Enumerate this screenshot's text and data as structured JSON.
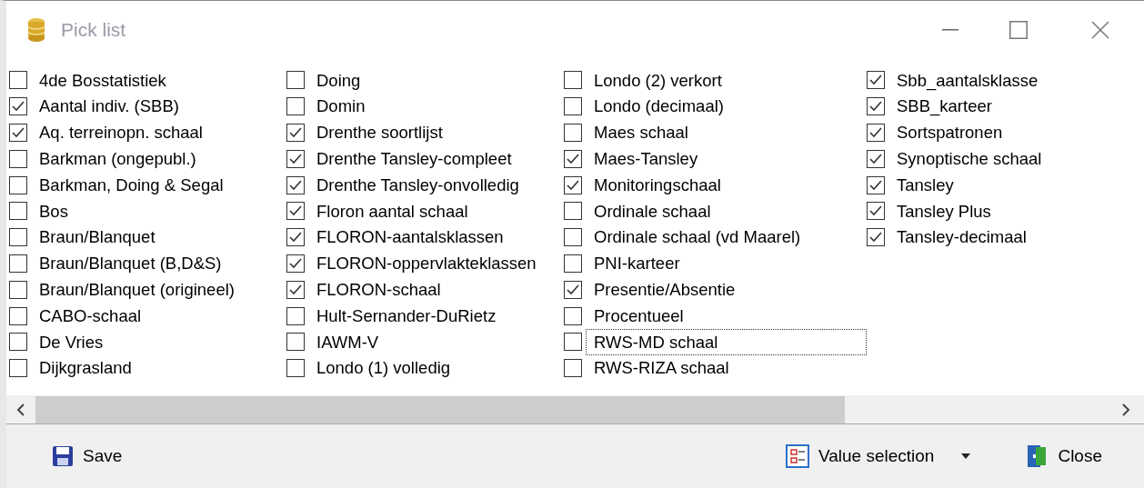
{
  "window": {
    "title": "Pick list"
  },
  "columns": [
    {
      "items": [
        {
          "label": "4de Bosstatistiek",
          "checked": false,
          "focused": false
        },
        {
          "label": "Aantal indiv. (SBB)",
          "checked": true,
          "focused": false
        },
        {
          "label": "Aq. terreinopn. schaal",
          "checked": true,
          "focused": false
        },
        {
          "label": "Barkman (ongepubl.)",
          "checked": false,
          "focused": false
        },
        {
          "label": "Barkman, Doing & Segal",
          "checked": false,
          "focused": false
        },
        {
          "label": "Bos",
          "checked": false,
          "focused": false
        },
        {
          "label": "Braun/Blanquet",
          "checked": false,
          "focused": false
        },
        {
          "label": "Braun/Blanquet (B,D&S)",
          "checked": false,
          "focused": false
        },
        {
          "label": "Braun/Blanquet (origineel)",
          "checked": false,
          "focused": false
        },
        {
          "label": "CABO-schaal",
          "checked": false,
          "focused": false
        },
        {
          "label": "De Vries",
          "checked": false,
          "focused": false
        },
        {
          "label": "Dijkgrasland",
          "checked": false,
          "focused": false
        }
      ]
    },
    {
      "items": [
        {
          "label": "Doing",
          "checked": false,
          "focused": false
        },
        {
          "label": "Domin",
          "checked": false,
          "focused": false
        },
        {
          "label": "Drenthe soortlijst",
          "checked": true,
          "focused": false
        },
        {
          "label": "Drenthe Tansley-compleet",
          "checked": true,
          "focused": false
        },
        {
          "label": "Drenthe Tansley-onvolledig",
          "checked": true,
          "focused": false
        },
        {
          "label": "Floron aantal schaal",
          "checked": true,
          "focused": false
        },
        {
          "label": "FLORON-aantalsklassen",
          "checked": true,
          "focused": false
        },
        {
          "label": "FLORON-oppervlakteklassen",
          "checked": true,
          "focused": false
        },
        {
          "label": "FLORON-schaal",
          "checked": true,
          "focused": false
        },
        {
          "label": "Hult-Sernander-DuRietz",
          "checked": false,
          "focused": false
        },
        {
          "label": "IAWM-V",
          "checked": false,
          "focused": false
        },
        {
          "label": "Londo (1) volledig",
          "checked": false,
          "focused": false
        }
      ]
    },
    {
      "items": [
        {
          "label": "Londo (2) verkort",
          "checked": false,
          "focused": false
        },
        {
          "label": "Londo (decimaal)",
          "checked": false,
          "focused": false
        },
        {
          "label": "Maes schaal",
          "checked": false,
          "focused": false
        },
        {
          "label": "Maes-Tansley",
          "checked": true,
          "focused": false
        },
        {
          "label": "Monitoringschaal",
          "checked": true,
          "focused": false
        },
        {
          "label": "Ordinale schaal",
          "checked": false,
          "focused": false
        },
        {
          "label": "Ordinale schaal (vd Maarel)",
          "checked": false,
          "focused": false
        },
        {
          "label": "PNI-karteer",
          "checked": false,
          "focused": false
        },
        {
          "label": "Presentie/Absentie",
          "checked": true,
          "focused": false
        },
        {
          "label": "Procentueel",
          "checked": false,
          "focused": false
        },
        {
          "label": "RWS-MD schaal",
          "checked": false,
          "focused": true
        },
        {
          "label": "RWS-RIZA schaal",
          "checked": false,
          "focused": false
        }
      ]
    },
    {
      "items": [
        {
          "label": "Sbb_aantalsklasse",
          "checked": true,
          "focused": false
        },
        {
          "label": "SBB_karteer",
          "checked": true,
          "focused": false
        },
        {
          "label": "Sortspatronen",
          "checked": true,
          "focused": false
        },
        {
          "label": "Synoptische schaal",
          "checked": true,
          "focused": false
        },
        {
          "label": "Tansley",
          "checked": true,
          "focused": false
        },
        {
          "label": "Tansley Plus",
          "checked": true,
          "focused": false
        },
        {
          "label": "Tansley-decimaal",
          "checked": true,
          "focused": false
        }
      ]
    }
  ],
  "toolbar": {
    "left": [
      {
        "kind": "save",
        "label": "Save"
      }
    ],
    "right": [
      {
        "kind": "value",
        "label": "Value selection",
        "dropdown": true
      },
      {
        "kind": "close",
        "label": "Close",
        "dropdown": false
      }
    ]
  }
}
